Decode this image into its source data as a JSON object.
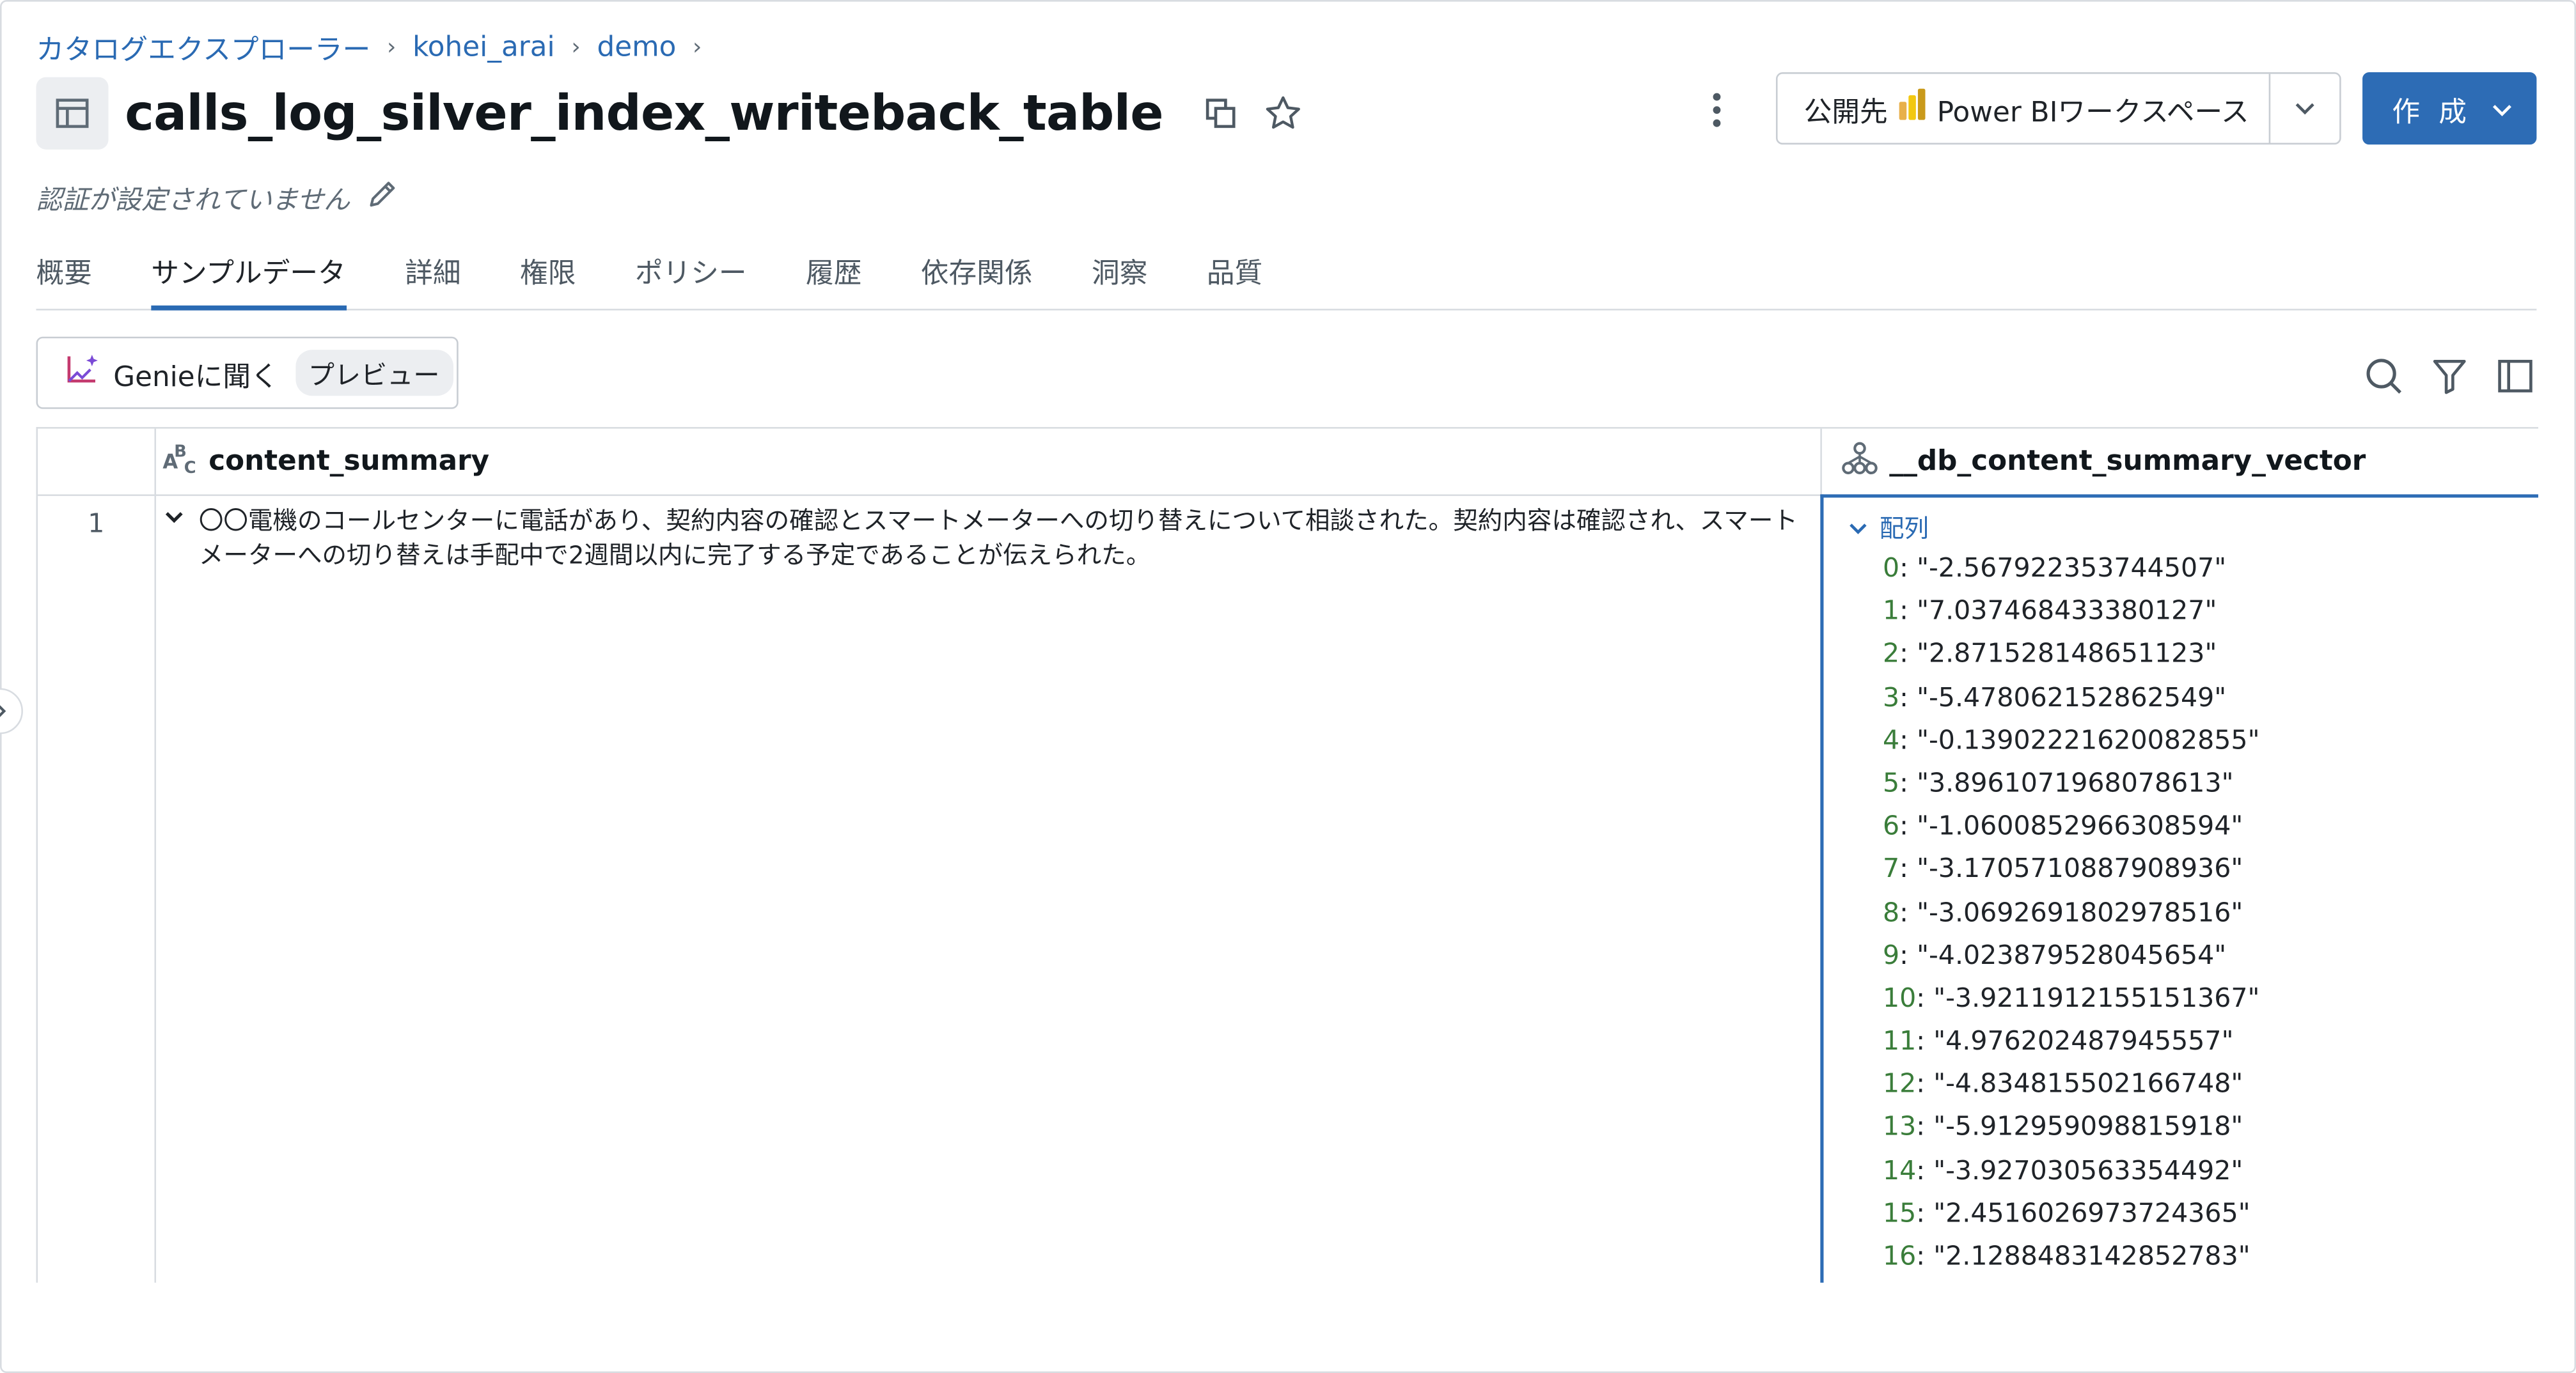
{
  "breadcrumb": {
    "items": [
      "カタログエクスプローラー",
      "kohei_arai",
      "demo"
    ],
    "separator": "›"
  },
  "header": {
    "title": "calls_log_silver_index_writeback_table",
    "certification": "認証が設定されていません",
    "publish_label": "公開先",
    "publish_target": "Power BIワークスペース",
    "create_label": "作 成"
  },
  "tabs": [
    {
      "label": "概要",
      "active": false
    },
    {
      "label": "サンプルデータ",
      "active": true
    },
    {
      "label": "詳細",
      "active": false
    },
    {
      "label": "権限",
      "active": false
    },
    {
      "label": "ポリシー",
      "active": false
    },
    {
      "label": "履歴",
      "active": false
    },
    {
      "label": "依存関係",
      "active": false
    },
    {
      "label": "洞察",
      "active": false
    },
    {
      "label": "品質",
      "active": false
    }
  ],
  "genie": {
    "label": "Genieに聞く",
    "badge": "プレビュー"
  },
  "table": {
    "columns": [
      {
        "name": "content_summary",
        "type_icon": "string-type-icon"
      },
      {
        "name": "__db_content_summary_vector",
        "type_icon": "struct-type-icon"
      }
    ],
    "rows": [
      {
        "index": "1",
        "content_summary": "〇〇電機のコールセンターに電話があり、契約内容の確認とスマートメーターへの切り替えについて相談された。契約内容は確認され、スマートメーターへの切り替えは手配中で2週間以内に完了する予定であることが伝えられた。",
        "vector_label": "配列",
        "vector": [
          {
            "k": "0",
            "v": "\"-2.567922353744507\""
          },
          {
            "k": "1",
            "v": "\"7.037468433380127\""
          },
          {
            "k": "2",
            "v": "\"2.871528148651123\""
          },
          {
            "k": "3",
            "v": "\"-5.478062152862549\""
          },
          {
            "k": "4",
            "v": "\"-0.13902221620082855\""
          },
          {
            "k": "5",
            "v": "\"3.8961071968078613\""
          },
          {
            "k": "6",
            "v": "\"-1.0600852966308594\""
          },
          {
            "k": "7",
            "v": "\"-3.1705710887908936\""
          },
          {
            "k": "8",
            "v": "\"-3.0692691802978516\""
          },
          {
            "k": "9",
            "v": "\"-4.023879528045654\""
          },
          {
            "k": "10",
            "v": "\"-3.9211912155151367\""
          },
          {
            "k": "11",
            "v": "\"4.976202487945557\""
          },
          {
            "k": "12",
            "v": "\"-4.834815502166748\""
          },
          {
            "k": "13",
            "v": "\"-5.912959098815918\""
          },
          {
            "k": "14",
            "v": "\"-3.927030563354492\""
          },
          {
            "k": "15",
            "v": "\"2.4516026973724365\""
          },
          {
            "k": "16",
            "v": "\"2.1288483142852783\""
          }
        ]
      }
    ]
  },
  "colors": {
    "accent": "#2d6cb5",
    "link": "#2a6ab3",
    "border": "#d8dce1",
    "vector_key": "#3a7d3a"
  }
}
